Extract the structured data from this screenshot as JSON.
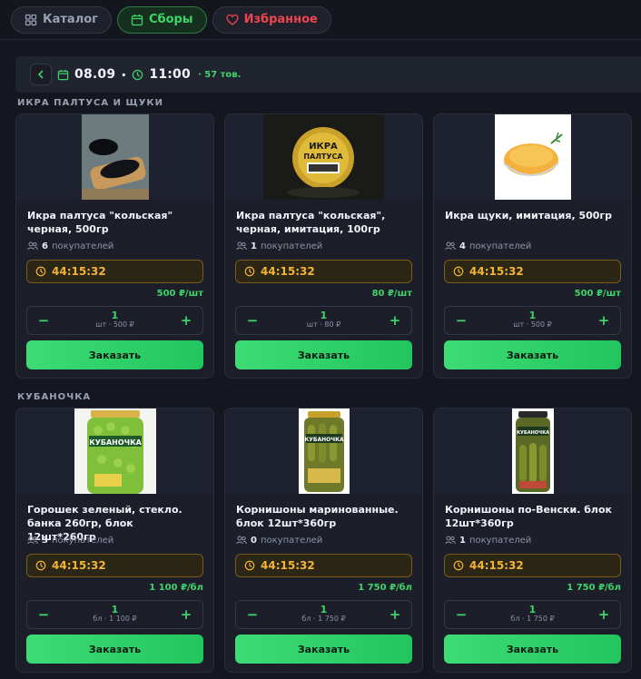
{
  "nav": {
    "catalog": "Каталог",
    "collections": "Сборы",
    "favorites": "Избранное"
  },
  "subbar": {
    "date": "08.09",
    "time": "11:00",
    "count": "· 57 тов."
  },
  "sections": [
    {
      "title": "ИКРА ПАЛТУСА И ЩУКИ",
      "products": [
        {
          "name": "Икра палтуса \"кольская\" черная, 500гр",
          "buyers_count": "6",
          "buyers_label": "покупателей",
          "timer": "44:15:32",
          "price": "500 ₽/шт",
          "qty": "1",
          "unit": "шт · 500 ₽",
          "order": "Заказать"
        },
        {
          "name": "Икра палтуса \"кольская\", черная, имитация, 100гр",
          "buyers_count": "1",
          "buyers_label": "покупателей",
          "timer": "44:15:32",
          "price": "80 ₽/шт",
          "qty": "1",
          "unit": "шт · 80 ₽",
          "order": "Заказать"
        },
        {
          "name": "Икра щуки, имитация, 500гр",
          "buyers_count": "4",
          "buyers_label": "покупателей",
          "timer": "44:15:32",
          "price": "500 ₽/шт",
          "qty": "1",
          "unit": "шт · 500 ₽",
          "order": "Заказать"
        }
      ]
    },
    {
      "title": "КУБАНОЧКА",
      "products": [
        {
          "name": "Горошек зеленый, стекло. банка 260гр, блок 12шт*260гр",
          "buyers_count": "3",
          "buyers_label": "покупателей",
          "timer": "44:15:32",
          "price": "1 100 ₽/бл",
          "qty": "1",
          "unit": "бл · 1 100 ₽",
          "order": "Заказать",
          "img_label": "КУБАНОЧКА"
        },
        {
          "name": "Корнишоны маринованные. блок 12шт*360гр",
          "buyers_count": "0",
          "buyers_label": "покупателей",
          "timer": "44:15:32",
          "price": "1 750 ₽/бл",
          "qty": "1",
          "unit": "бл · 1 750 ₽",
          "order": "Заказать",
          "img_label": "КУБАНОЧКА"
        },
        {
          "name": "Корнишоны по-Венски. блок 12шт*360гр",
          "buyers_count": "1",
          "buyers_label": "покупателей",
          "timer": "44:15:32",
          "price": "1 750 ₽/бл",
          "qty": "1",
          "unit": "бл · 1 750 ₽",
          "order": "Заказать",
          "img_label": "КУБАНОЧКА"
        }
      ]
    }
  ],
  "product_images": {
    "p1_2_label": "ИКРА ПАЛТУСА"
  },
  "colors": {
    "accent": "#3fd46a",
    "timer": "#f3b436",
    "favorite": "#f0454f",
    "background": "#141720",
    "card": "#1c1f29"
  }
}
